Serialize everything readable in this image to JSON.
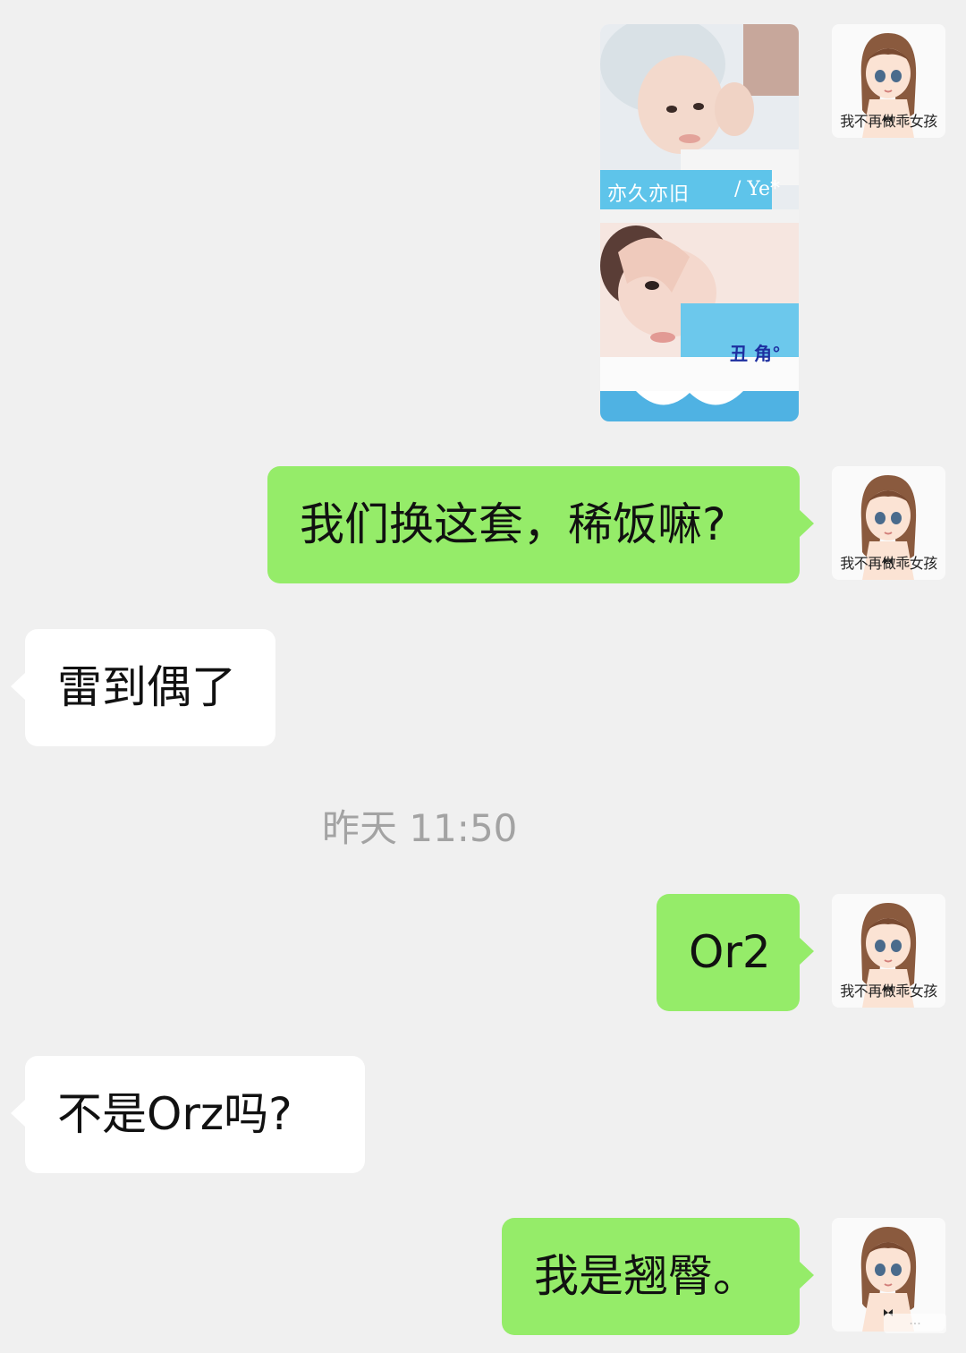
{
  "chat": {
    "avatar_caption": "我不再做乖女孩",
    "photo": {
      "top_caption_left": "亦久亦旧",
      "top_caption_right": "/ Ye*",
      "bottom_caption": "丑 角°"
    },
    "messages": [
      {
        "side": "out",
        "text": "我们换这套，稀饭嘛?"
      },
      {
        "side": "in",
        "text": "雷到偶了"
      },
      {
        "side": "out",
        "text": "Or2"
      },
      {
        "side": "in",
        "text": "不是Orz吗?"
      },
      {
        "side": "out",
        "text": "我是翘臀。"
      }
    ],
    "timestamp": "昨天 11:50"
  },
  "colors": {
    "background": "#f0f0f0",
    "outgoing_bubble": "#95ec69",
    "incoming_bubble": "#ffffff",
    "timestamp_text": "#a3a3a3"
  }
}
